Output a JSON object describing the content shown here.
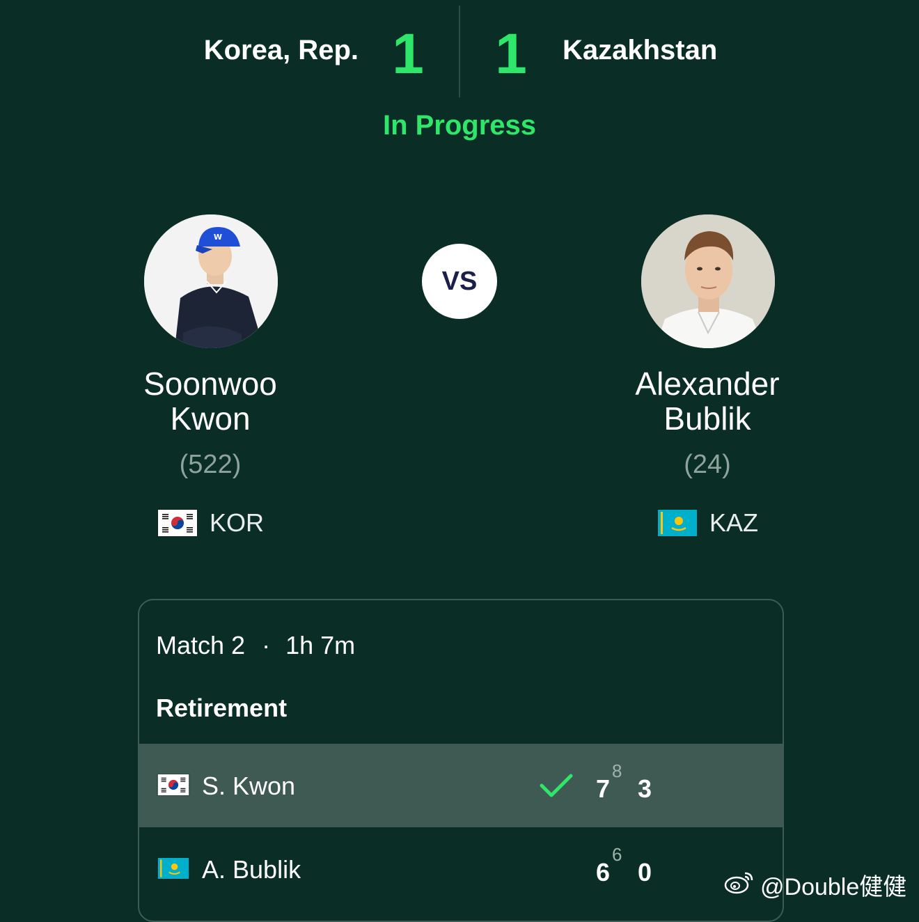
{
  "tie": {
    "home_team": "Korea, Rep.",
    "away_team": "Kazakhstan",
    "home_score": "1",
    "away_score": "1",
    "status": "In Progress"
  },
  "vs_label": "VS",
  "players": {
    "home": {
      "first_name": "Soonwoo",
      "last_name": "Kwon",
      "rank": "(522)",
      "country_code": "KOR",
      "flag_icon": "south-korea-flag-icon"
    },
    "away": {
      "first_name": "Alexander",
      "last_name": "Bublik",
      "rank": "(24)",
      "country_code": "KAZ",
      "flag_icon": "kazakhstan-flag-icon"
    }
  },
  "match": {
    "label": "Match 2",
    "separator": "·",
    "duration": "1h 7m",
    "result": "Retirement",
    "rows": [
      {
        "name": "S. Kwon",
        "winner": true,
        "set1": "7",
        "set1_tiebreak": "8",
        "set2": "3"
      },
      {
        "name": "A. Bublik",
        "winner": false,
        "set1": "6",
        "set1_tiebreak": "6",
        "set2": "0"
      }
    ]
  },
  "watermark": "@Double健健",
  "colors": {
    "background": "#0a2e25",
    "accent_green": "#2ee66a",
    "highlight_row": "#3f5a52",
    "rank_gray": "#8fa39c"
  }
}
